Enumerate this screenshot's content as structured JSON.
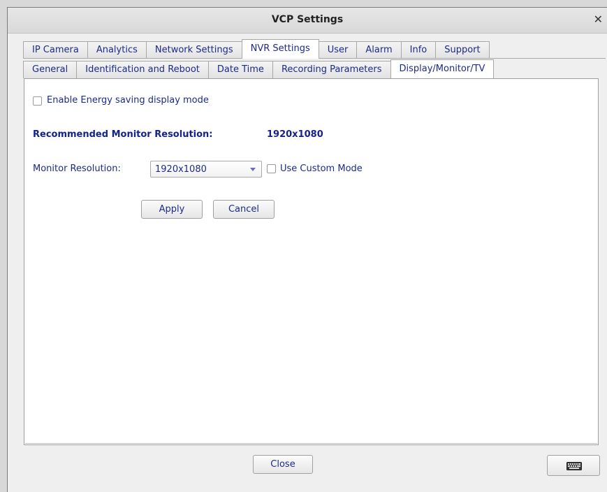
{
  "window": {
    "title": "VCP Settings",
    "close_symbol": "✕"
  },
  "main_tabs": [
    {
      "label": "IP Camera"
    },
    {
      "label": "Analytics"
    },
    {
      "label": "Network Settings"
    },
    {
      "label": "NVR Settings",
      "active": true
    },
    {
      "label": "User"
    },
    {
      "label": "Alarm"
    },
    {
      "label": "Info"
    },
    {
      "label": "Support"
    }
  ],
  "sub_tabs": [
    {
      "label": "General"
    },
    {
      "label": "Identification and Reboot"
    },
    {
      "label": "Date Time"
    },
    {
      "label": "Recording Parameters"
    },
    {
      "label": "Display/Monitor/TV",
      "active": true
    }
  ],
  "display": {
    "energy_saving_label": "Enable Energy saving display mode",
    "energy_saving_checked": false,
    "recommended_label": "Recommended Monitor Resolution:",
    "recommended_value": "1920x1080",
    "resolution_label": "Monitor Resolution:",
    "resolution_value": "1920x1080",
    "custom_mode_label": "Use Custom Mode",
    "custom_mode_checked": false,
    "apply_label": "Apply",
    "cancel_label": "Cancel"
  },
  "footer": {
    "close_label": "Close",
    "keyboard_icon": "keyboard-icon"
  },
  "colors": {
    "text": "#1c2a8a",
    "background": "#efefef",
    "panel": "#ffffff"
  }
}
